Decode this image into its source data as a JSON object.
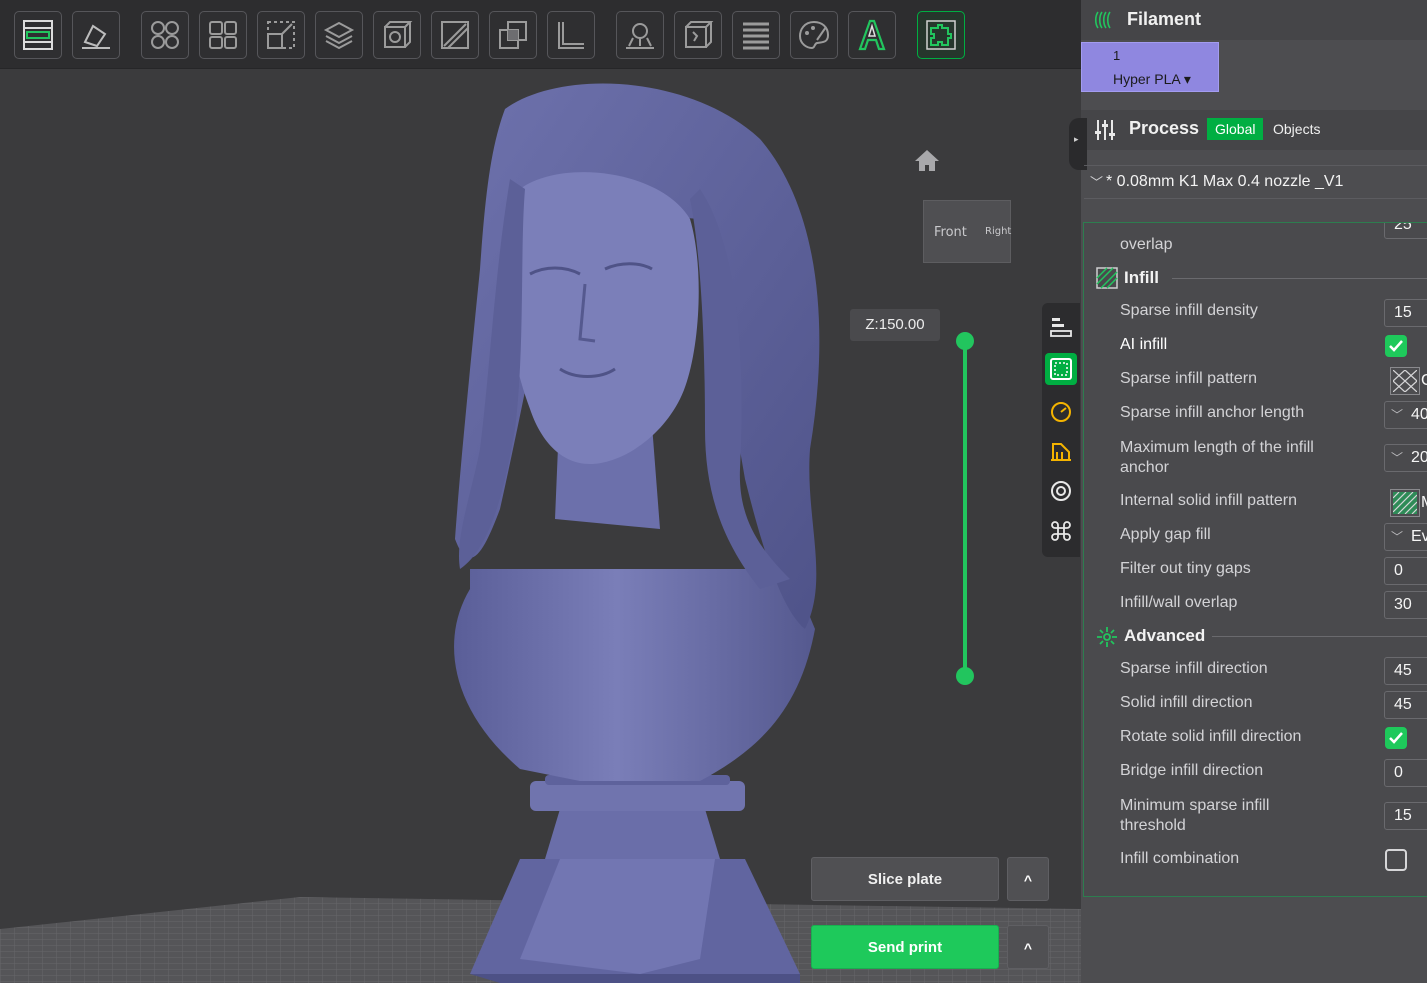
{
  "toolbar": {
    "buttons": [
      {
        "icon": "layout-icon"
      },
      {
        "icon": "orient-icon"
      },
      {
        "icon": "arrange-icon"
      },
      {
        "icon": "split-icon"
      },
      {
        "icon": "scale-icon"
      },
      {
        "icon": "layers-icon"
      },
      {
        "icon": "cube-icon"
      },
      {
        "icon": "cut-icon"
      },
      {
        "icon": "boolean-icon"
      },
      {
        "icon": "measure-icon"
      },
      {
        "icon": "support-paint-icon"
      },
      {
        "icon": "seam-icon"
      },
      {
        "icon": "variable-layer-icon"
      },
      {
        "icon": "color-paint-icon"
      },
      {
        "icon": "text-icon"
      },
      {
        "icon": "assembly-icon"
      }
    ]
  },
  "viewport": {
    "z_label": "Z:150.00",
    "cube_front": "Front",
    "cube_right": "Right",
    "model_color": "#6b6fa8",
    "slice_label": "Slice plate",
    "send_label": "Send print",
    "more_label": "^"
  },
  "sidebar": {
    "filament": {
      "title": "Filament",
      "slot_number": "1",
      "slot_name": "Hyper PLA ▾",
      "slot_color": "#8f87e0"
    },
    "process": {
      "title": "Process",
      "tab_global": "Global",
      "tab_objects": "Objects",
      "preset_name": "* 0.08mm K1 Max 0.4 nozzle _V1"
    },
    "settings": {
      "cut_top_value": "25",
      "cut_top_label": "overlap",
      "infill_section": "Infill",
      "rows": [
        {
          "label": "Sparse infill density",
          "value": "15"
        },
        {
          "label": "AI infill"
        },
        {
          "label": "Sparse infill pattern",
          "value": "G"
        },
        {
          "label": "Sparse infill anchor length",
          "value": "40"
        },
        {
          "label": "Maximum length of the infill anchor",
          "value": "20"
        },
        {
          "label": "Internal solid infill pattern",
          "value": "M"
        },
        {
          "label": "Apply gap fill",
          "value": "Ev"
        },
        {
          "label": "Filter out tiny gaps",
          "value": "0"
        },
        {
          "label": "Infill/wall overlap",
          "value": "30"
        }
      ],
      "advanced_section": "Advanced",
      "adv_rows": [
        {
          "label": "Sparse infill direction",
          "value": "45"
        },
        {
          "label": "Solid infill direction",
          "value": "45"
        },
        {
          "label": "Rotate solid infill direction"
        },
        {
          "label": "Bridge infill direction",
          "value": "0"
        },
        {
          "label": "Minimum sparse infill threshold",
          "value": "15"
        },
        {
          "label": "Infill combination"
        }
      ]
    }
  },
  "colors": {
    "accent": "#00ae42",
    "model": "#6b6fa8"
  }
}
